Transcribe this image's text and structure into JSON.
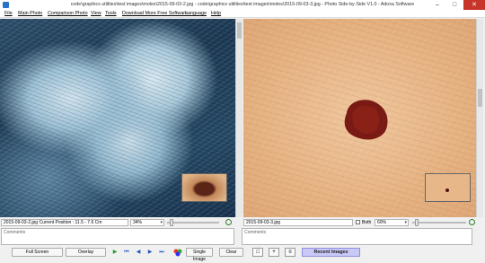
{
  "window": {
    "title": "code\\graphics utilities\\test images\\moles\\2015-09-03-2.jpg - code\\graphics utilities\\test images\\moles\\2015-09-03-3.jpg - Photo Side-by-Side V1.0 - Adoxa Software",
    "min_glyph": "–",
    "max_glyph": "□",
    "close_glyph": "✕"
  },
  "menu": {
    "items": [
      "File",
      "Main Photo",
      "Comparison Photo",
      "View",
      "Tools",
      "Download More Free Software",
      "Language",
      "Help"
    ]
  },
  "left": {
    "info": "2015-09-03-2.jpg Current Position : 11.5 - 7.6 Cm",
    "zoom_value": "34%",
    "comments_placeholder": "Comments",
    "slider_level": 0.05
  },
  "right": {
    "info": "2015-09-03-3.jpg",
    "both_label": "Both",
    "zoom_value": "60%",
    "comments_placeholder": "Comments",
    "slider_level": 0.05
  },
  "toolbar": {
    "full_screen": "Full Screen",
    "overlay": "Overlay",
    "single_image": "Single Image",
    "clear": "Clear",
    "recent_images": "Recent Images",
    "nav_glyphs": {
      "play": "▶",
      "first": "⏮",
      "prev": "◀",
      "next": "▶",
      "last": "⏭"
    },
    "tool_glyphs": {
      "rect": "□",
      "cross": "+",
      "lines": "≡"
    }
  },
  "icons": {
    "app": "app-icon",
    "zoom": "zoom-icon",
    "color_picker": "color-picker-icon"
  },
  "colors": {
    "recent_button": "#c9c9f7",
    "close_button": "#c7352a",
    "play_green": "#1c9b2c",
    "nav_blue": "#1f56c0"
  }
}
